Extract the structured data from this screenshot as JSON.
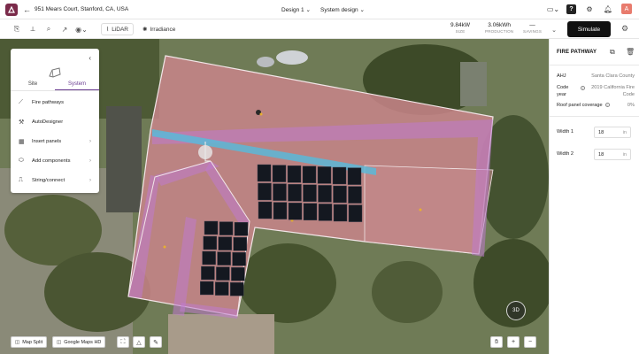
{
  "header": {
    "address": "951 Mears Court, Stanford, CA, USA",
    "design_label": "Design 1",
    "system_label": "System design",
    "user_initial": "A",
    "help_label": "?"
  },
  "toolbar": {
    "lidar_label": "LiDAR",
    "irradiance_label": "Irradiance",
    "size_value": "9.84kW",
    "size_label": "SIZE",
    "production_value": "3.06kWh",
    "production_label": "PRODUCTION",
    "savings_value": "—",
    "savings_label": "SAVINGS",
    "simulate_label": "Simulate"
  },
  "left_panel": {
    "tabs": [
      "Site",
      "System"
    ],
    "active_tab": "System",
    "items": [
      {
        "label": "Fire pathways",
        "icon": "fire-pathway-icon",
        "chevron": false
      },
      {
        "label": "AutoDesigner",
        "icon": "wand-icon",
        "chevron": false
      },
      {
        "label": "Insert panels",
        "icon": "panel-grid-icon",
        "chevron": true
      },
      {
        "label": "Add components",
        "icon": "component-icon",
        "chevron": true
      },
      {
        "label": "String/connect",
        "icon": "string-icon",
        "chevron": true
      }
    ]
  },
  "map_controls": {
    "map_split_label": "Map Split",
    "basemap_label": "Google Maps HD",
    "view_3d_label": "3D"
  },
  "right_panel": {
    "title": "FIRE PATHWAY",
    "ahj_label": "AHJ",
    "ahj_value": "Santa Clara County",
    "code_year_label": "Code year",
    "code_year_value": "2019 California Fire Code",
    "coverage_label": "Roof panel coverage",
    "coverage_value": "0%",
    "width1_label": "Width 1",
    "width1_value": "18",
    "width2_label": "Width 2",
    "width2_value": "18",
    "width_unit": "in"
  },
  "colors": {
    "brand": "#7a2a4a",
    "roof_overlay": "#c9858a",
    "fire_pathway": "#c07ad0",
    "ridge": "#5bb8d8",
    "panel": "#141820",
    "tab_active": "#6a3c91"
  }
}
